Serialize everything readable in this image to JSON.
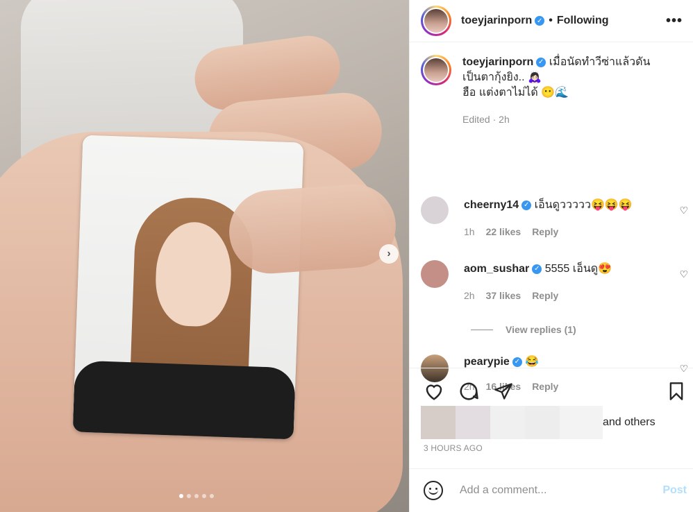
{
  "post": {
    "username": "toeyjarinporn",
    "follow_status": "Following",
    "more_icon": "ellipsis-icon",
    "caption_lines": [
      "เมื่อนัดทำวีซ่าแล้วดัน",
      "เป็นตากุ้งยิง.. 🙇🏻‍♀️",
      "ฮือ แต่งตาไม่ได้ 😶🌊"
    ],
    "edited": "Edited",
    "caption_time": "2h",
    "carousel_dots": 5,
    "carousel_active": 0
  },
  "comments": [
    {
      "username": "cheerny14",
      "text": "เอ็นดูววววว😝😝😝",
      "time": "1h",
      "likes": "22 likes",
      "reply": "Reply",
      "avatar_color": "#d9d3d8"
    },
    {
      "username": "aom_sushar",
      "text": "5555 เอ็นดู😍",
      "time": "2h",
      "likes": "37 likes",
      "reply": "Reply",
      "avatar_color": "#c48f86"
    },
    {
      "username": "pearypie",
      "text": "😂",
      "time": "2h",
      "likes": "16 likes",
      "reply": "Reply",
      "avatar_color": "#6a5a4a"
    }
  ],
  "view_replies": "View replies (1)",
  "likes": {
    "and_others": "and others"
  },
  "posted_ago": "3 HOURS AGO",
  "add_comment": {
    "placeholder": "Add a comment...",
    "post_label": "Post"
  },
  "colors": {
    "verified": "#3897f0",
    "meta_gray": "#8e8e8e",
    "post_disabled": "#b2dffc"
  }
}
